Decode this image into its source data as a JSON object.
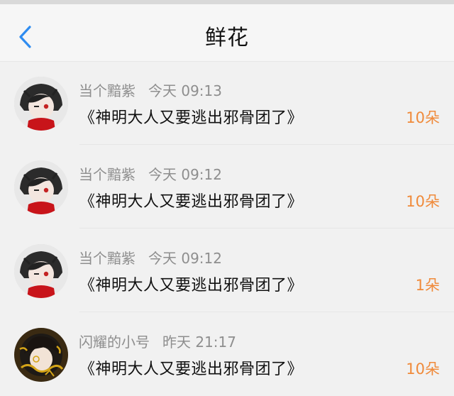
{
  "header": {
    "title": "鲜花"
  },
  "gifts": [
    {
      "user": "当个黯紫",
      "time": "今天 09:13",
      "book": "《神明大人又要逃出邪骨团了》",
      "count": "10朵",
      "avatar": "dark-hair-avatar"
    },
    {
      "user": "当个黯紫",
      "time": "今天 09:12",
      "book": "《神明大人又要逃出邪骨团了》",
      "count": "10朵",
      "avatar": "dark-hair-avatar"
    },
    {
      "user": "当个黯紫",
      "time": "今天 09:12",
      "book": "《神明大人又要逃出邪骨团了》",
      "count": "1朵",
      "avatar": "dark-hair-avatar"
    },
    {
      "user": "闪耀的小号",
      "time": "昨天 21:17",
      "book": "《神明大人又要逃出邪骨团了》",
      "count": "10朵",
      "avatar": "gold-chain-avatar"
    }
  ],
  "colors": {
    "accent": "#f08a3a",
    "back": "#2f8cf0",
    "meta": "#8e8e8e"
  }
}
